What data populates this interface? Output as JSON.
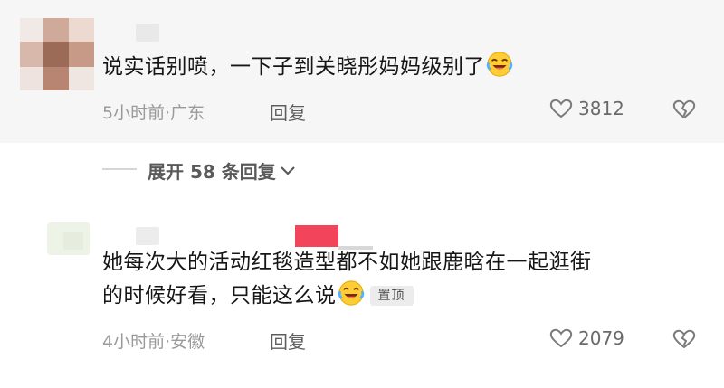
{
  "comments": [
    {
      "text": "说实话别喷，一下子到关晓彤妈妈级别了",
      "emoji": "rolling-laughing-emoji",
      "meta": "5小时前·广东",
      "reply_label": "回复",
      "likes": "3812"
    },
    {
      "text_line1": "她每次大的活动红毯造型都不如她跟鹿晗在一起逛街",
      "text_line2": "的时候好看，只能这么说",
      "emoji": "rolling-laughing-emoji",
      "pinned_label": "置顶",
      "meta": "4小时前·安徽",
      "reply_label": "回复",
      "likes": "2079"
    }
  ],
  "expand_replies": {
    "label": "展开 58 条回复",
    "icon": "chevron-down-icon"
  },
  "icons": {
    "like": "heart-outline-icon",
    "dislike": "broken-heart-icon"
  },
  "colors": {
    "text": "#161616",
    "meta": "#9a9a9a",
    "highlight_bg": "#f6f6f6",
    "accent_red": "#f2445a"
  }
}
